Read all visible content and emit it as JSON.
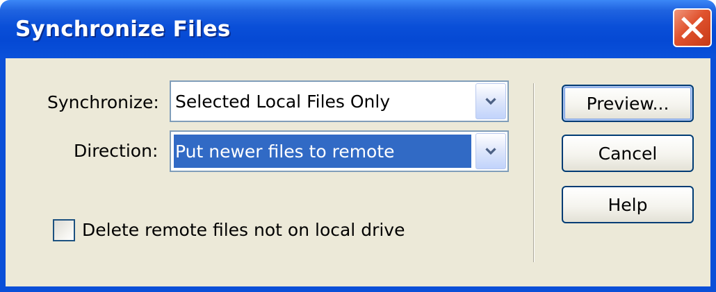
{
  "dialog": {
    "title": "Synchronize Files",
    "close_icon": "close-icon"
  },
  "form": {
    "synchronize": {
      "label": "Synchronize:",
      "value": "Selected Local Files Only"
    },
    "direction": {
      "label": "Direction:",
      "value": "Put newer files to remote"
    },
    "delete_remote": {
      "label": "Delete remote files not on local drive",
      "checked": false
    }
  },
  "buttons": {
    "preview": "Preview...",
    "cancel": "Cancel",
    "help": "Help"
  },
  "colors": {
    "titlebar": "#0a4fd8",
    "client_bg": "#ece9d8",
    "selection": "#316ac5",
    "close": "#e0522e"
  }
}
